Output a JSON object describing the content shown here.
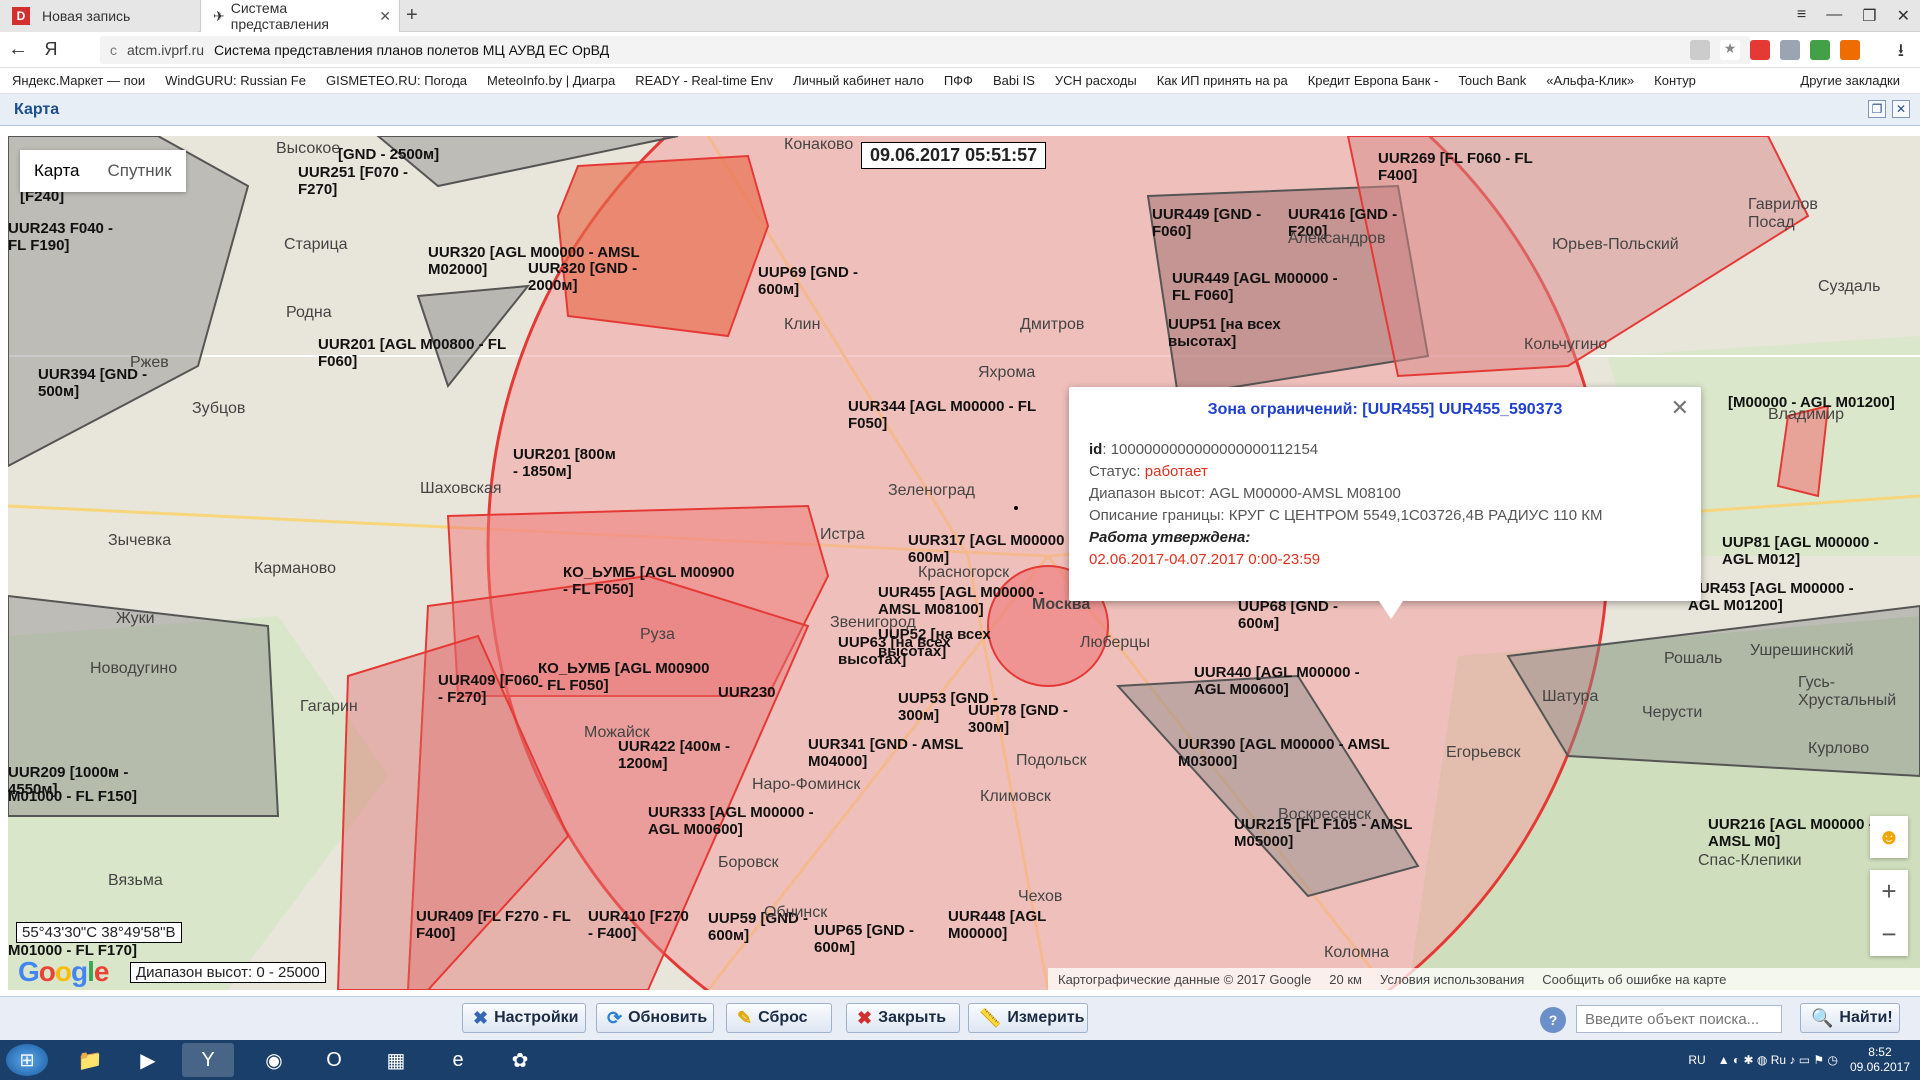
{
  "browser": {
    "tabs": [
      {
        "label": "Новая запись"
      },
      {
        "label": "Система представления"
      }
    ],
    "new_tab": "+",
    "address": {
      "domain": "atcm.ivprf.ru",
      "page_title": "Система представления планов полетов МЦ АУВД ЕС ОрВД"
    },
    "bookmarks": [
      "Яндекс.Маркет — пои",
      "WindGURU: Russian Fe",
      "GISMETEO.RU: Погода",
      "MeteoInfo.by | Диагра",
      "READY - Real-time Env",
      "Личный кабинет нало",
      "ПФФ",
      "Babi IS",
      "УСН расходы",
      "Как ИП принять на ра",
      "Кредит Европа Банк -",
      "Touch Bank",
      "«Альфа-Клик»",
      "Контур"
    ],
    "other_bookmarks": "Другие закладки"
  },
  "app": {
    "title": "Карта"
  },
  "map": {
    "type_buttons": {
      "map": "Карта",
      "satellite": "Спутник"
    },
    "timestamp": "09.06.2017 05:51:57",
    "coords": "55°43'30\"С 38°49'58\"В",
    "alt_range": "Диапазон высот: 0 - 25000",
    "attribution": "Картографические данные © 2017 Google",
    "scale": "20 км",
    "terms": "Условия использования",
    "report": "Сообщить об ошибке на карте",
    "cities": [
      "Конаково",
      "Высокое",
      "Старица",
      "Родна",
      "Ржев",
      "Зубцов",
      "Шаховская",
      "Зычевка",
      "Карманово",
      "Жуки",
      "Новодугино",
      "Гагарин",
      "Вязьма",
      "Руза",
      "Истра",
      "Клин",
      "Дмитров",
      "Яхрома",
      "Зеленоград",
      "Красногорск",
      "Звенигород",
      "Можайск",
      "Наро-Фоминск",
      "Подольск",
      "Климовск",
      "Обнинск",
      "Боровск",
      "Чехов",
      "Люберцы",
      "Александров",
      "Юрьев-Польский",
      "Гаврилов Посад",
      "Суздаль",
      "Кольчугино",
      "Владимир",
      "Ушрешинский",
      "Рошаль",
      "Шатура",
      "Черусти",
      "Гусь-Хрустальный",
      "Егорьевск",
      "Воскресенск",
      "Коломна",
      "Спас-Клепики",
      "Курлово",
      "Москва"
    ],
    "zones": [
      "UUR251 [F070 - F270]",
      "[GND - 2500м]",
      "UUR243 F040 - FL F190]",
      "[F240]",
      "UUR320 [AGL M00000 - AMSL M02000]",
      "UUR320 [GND - 2000м]",
      "UUP69 [GND - 600м]",
      "UUR201 [AGL M00800 - FL F060]",
      "UUR394 [GND - 500м]",
      "UUR201 [800м - 1850м]",
      "UUR344 [AGL M00000 - FL F050]",
      "UUR317 [AGL M00000 - 600м]",
      "UUR455 [AGL M00000 - AMSL M08100]",
      "UUP52 [на всех высотах]",
      "UUP63 [на всех высотах]",
      "КО_ЬУМБ [AGL M00900 - FL F050]",
      "КО_ЬУМБ [AGL M00900 - FL F050]",
      "UUR409 [F060 - F270]",
      "UUR422 [400м - 1200м]",
      "UUR230",
      "UUP53 [GND - 300м]",
      "UUP78 [GND - 300м]",
      "UUR341 [GND - AMSL M04000]",
      "UUR333 [AGL M00000 - AGL M00600]",
      "UUR409 [FL F270 - FL F400]",
      "UUR410 [F270 - F400]",
      "UUP59 [GND - 600м]",
      "UUP65 [GND - 600м]",
      "UUR448 [AGL M00000]",
      "UUR269 [FL F060 - FL F400]",
      "UUR449 [GND - F060]",
      "UUR416 [GND - F200]",
      "UUR449 [AGL M00000 - FL F060]",
      "UUP51 [на всех высотах]",
      "UUP68 [GND - 600м]",
      "UUR440 [AGL M00000 - AGL M00600]",
      "UUR390 [AGL M00000 - AMSL M03000]",
      "UUR215 [FL F105 - AMSL M05000]",
      "UUR216 [AGL M00000 - AMSL M0]",
      "UUP81 [AGL M00000 - AGL M012]",
      "UUR453 [AGL M00000 - AGL M01200]",
      "[M00000 - AGL M01200]",
      "UUR209 [1000м - 4550м]",
      "M01000 - FL F150]",
      "M01000 - FL F170]"
    ]
  },
  "popup": {
    "title": "Зона ограничений: [UUR455] UUR455_590373",
    "id_label": "id",
    "id_value": "1000000000000000000112154",
    "status_label": "Статус:",
    "status_value": "работает",
    "range_label": "Диапазон высот:",
    "range_value": "AGL M00000-AMSL M08100",
    "desc_label": "Описание границы:",
    "desc_value": "КРУГ С ЦЕНТРОМ 5549,1С03726,4В РАДИУС 110 КМ",
    "work_label": "Работа утверждена:",
    "work_value": "02.06.2017-04.07.2017 0:00-23:59"
  },
  "toolbar": {
    "settings": "Настройки",
    "refresh": "Обновить",
    "reset": "Сброс",
    "close": "Закрыть",
    "measure": "Измерить",
    "search_placeholder": "Введите объект поиска...",
    "find": "Найти!"
  },
  "taskbar": {
    "lang": "RU",
    "time": "8:52",
    "date": "09.06.2017"
  },
  "colors": {
    "zone_fill": "#f28c8c",
    "zone_stroke": "#e53935",
    "gray_zone": "#8a8a8a"
  }
}
